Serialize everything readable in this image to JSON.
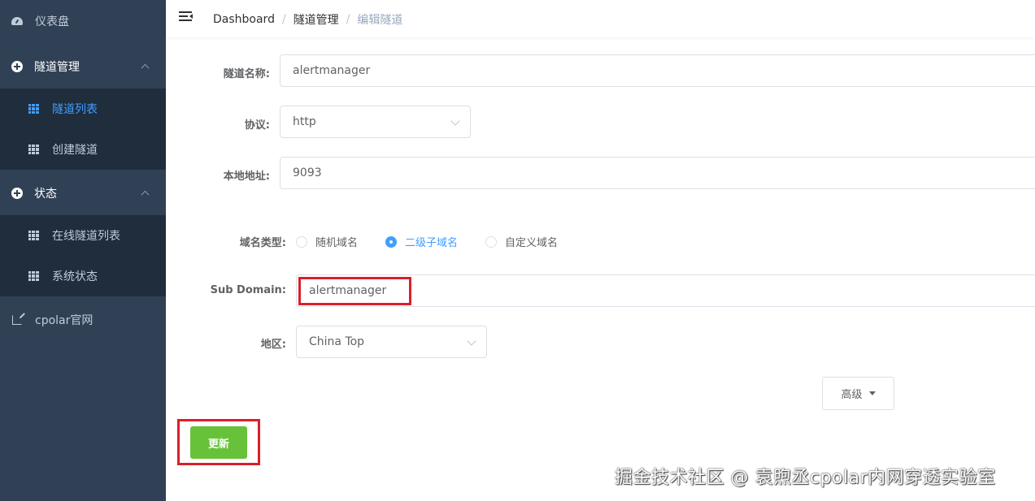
{
  "sidebar": {
    "dashboard": "仪表盘",
    "tunnel_mgmt": "隧道管理",
    "tunnel_list": "隧道列表",
    "create_tunnel": "创建隧道",
    "status": "状态",
    "online_tunnels": "在线隧道列表",
    "system_status": "系统状态",
    "cpolar_site": "cpolar官网"
  },
  "breadcrumb": {
    "home": "Dashboard",
    "section": "隧道管理",
    "current": "编辑隧道",
    "separator": "/"
  },
  "form": {
    "name_label": "隧道名称:",
    "name_value": "alertmanager",
    "protocol_label": "协议:",
    "protocol_value": "http",
    "local_addr_label": "本地地址:",
    "local_addr_value": "9093",
    "domain_type_label": "域名类型:",
    "domain_types": [
      "随机域名",
      "二级子域名",
      "自定义域名"
    ],
    "domain_type_selected": "二级子域名",
    "subdomain_label": "Sub Domain:",
    "subdomain_value": "alertmanager",
    "region_label": "地区:",
    "region_value": "China Top",
    "advanced_label": "高级",
    "update_label": "更新"
  },
  "colors": {
    "sidebar_bg": "#304156",
    "submenu_bg": "#1f2d3d",
    "active": "#409eff",
    "update_btn": "#67c23a",
    "highlight": "#d9202a"
  },
  "watermark": "掘金技术社区 @ 袁煦丞cpolar内网穿透实验室"
}
